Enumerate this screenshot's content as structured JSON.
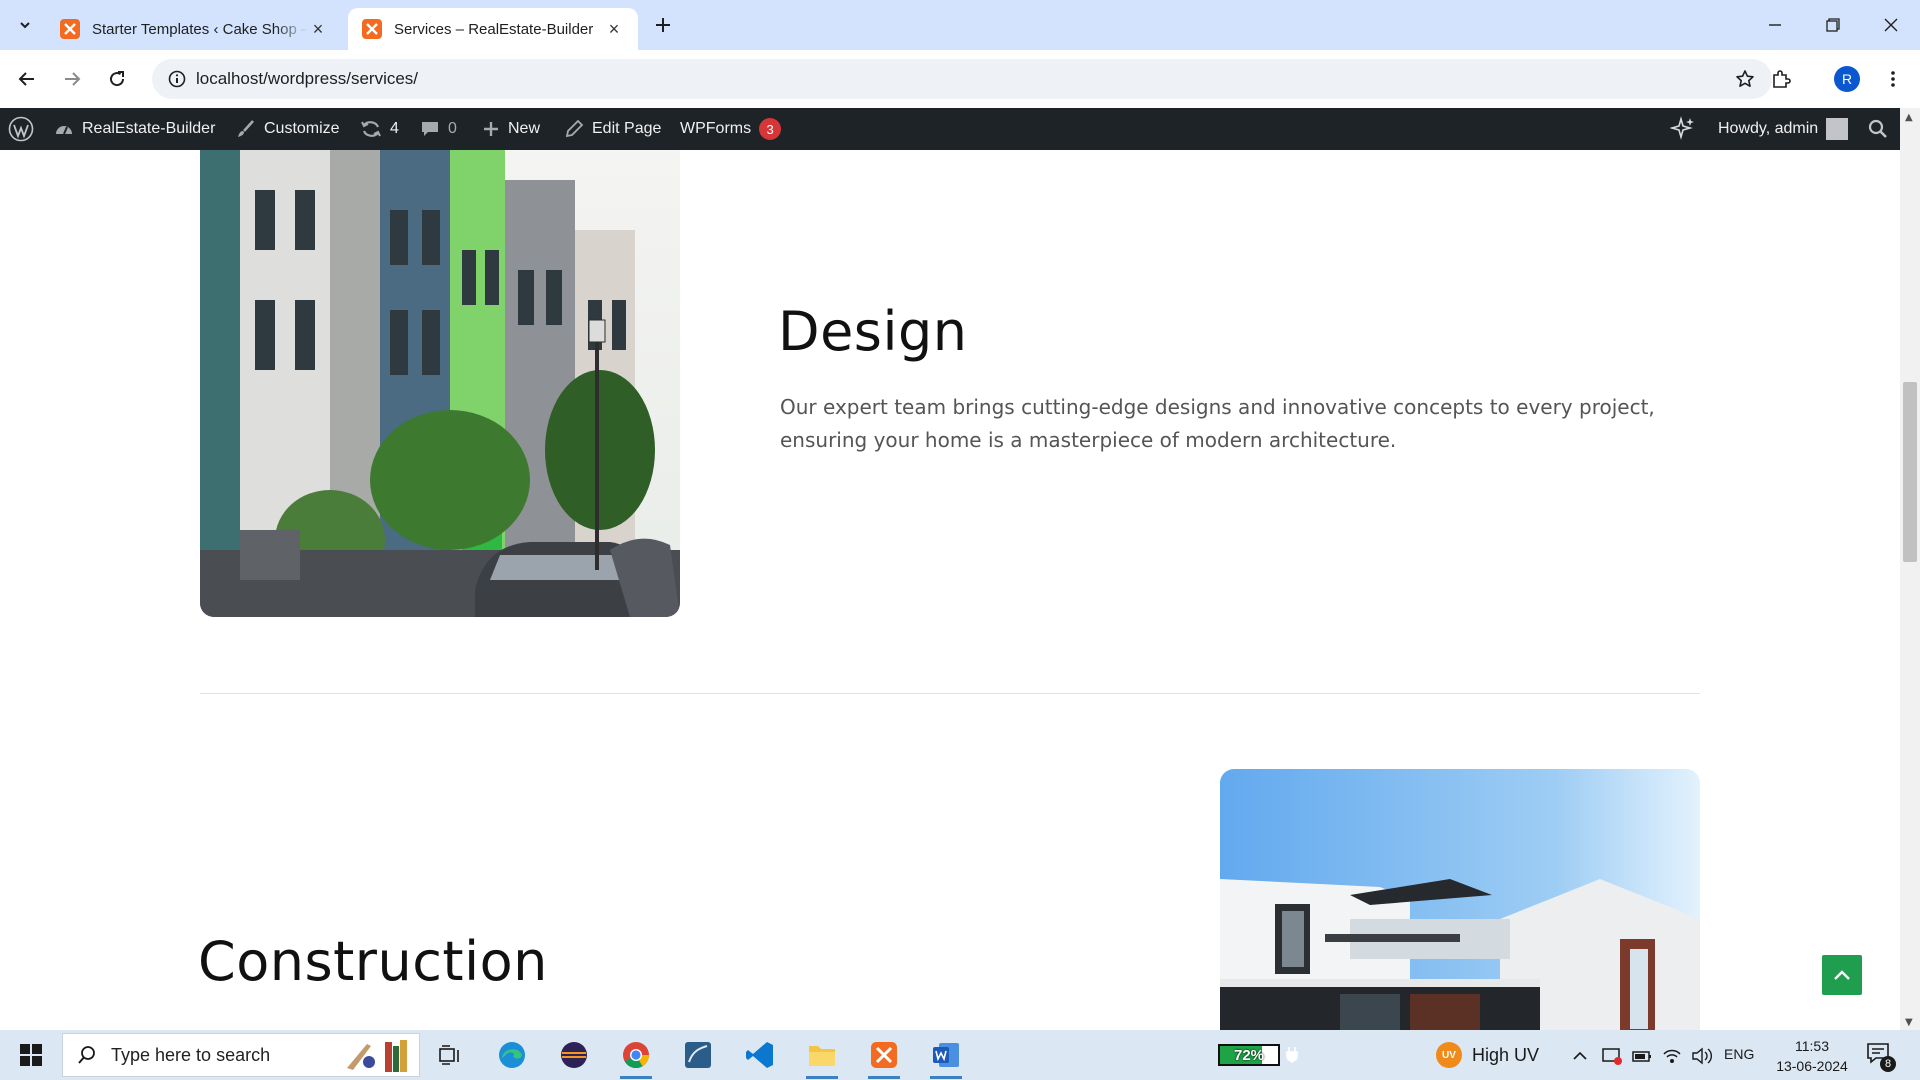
{
  "browser": {
    "tabs": [
      {
        "title": "Starter Templates ‹ Cake Shop –",
        "active": false
      },
      {
        "title": "Services – RealEstate-Builder",
        "active": true
      }
    ],
    "url": "localhost/wordpress/services/",
    "profile_initial": "R"
  },
  "admin_bar": {
    "site_name": "RealEstate-Builder",
    "customize": "Customize",
    "updates_count": "4",
    "comments_count": "0",
    "new": "New",
    "edit_page": "Edit Page",
    "wpforms": "WPForms",
    "wpforms_count": "3",
    "greeting": "Howdy, admin"
  },
  "content": {
    "design": {
      "title": "Design",
      "text": "Our expert team brings cutting-edge designs and innovative concepts to every project, ensuring your home is a masterpiece of modern architecture."
    },
    "construction": {
      "title": "Construction"
    }
  },
  "taskbar": {
    "search_placeholder": "Type here to search",
    "battery_percent": "72%",
    "battery_level": 0.72,
    "uv_badge": "UV",
    "uv_label": "High UV",
    "language": "ENG",
    "time": "11:53",
    "date": "13-06-2024",
    "notification_count": "8"
  },
  "colors": {
    "tab_strip": "#d3e3fd",
    "admin_bar": "#1d2327",
    "badge_red": "#d63638",
    "scroll_top_green": "#1f9e4f",
    "favicon_orange": "#f26b21"
  }
}
